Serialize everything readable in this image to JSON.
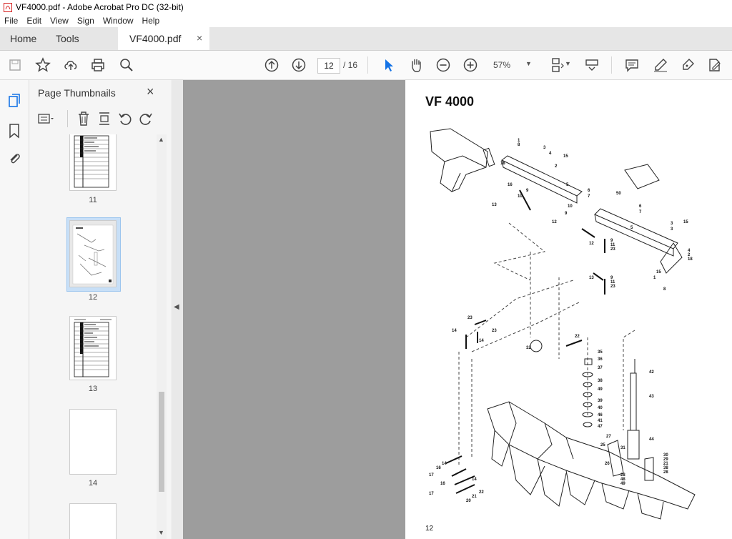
{
  "window": {
    "title": "VF4000.pdf - Adobe Acrobat Pro DC (32-bit)"
  },
  "menu": [
    "File",
    "Edit",
    "View",
    "Sign",
    "Window",
    "Help"
  ],
  "tabs": {
    "home": "Home",
    "tools": "Tools",
    "document": "VF4000.pdf",
    "close": "×"
  },
  "toolbar": {
    "current_page": "12",
    "total_pages": "/ 16",
    "zoom": "57%",
    "zoom_arrow": "▼"
  },
  "thumbnails_panel": {
    "title": "Page Thumbnails",
    "close": "×",
    "pages": [
      {
        "label": "11",
        "selected": false
      },
      {
        "label": "12",
        "selected": true
      },
      {
        "label": "13",
        "selected": false
      },
      {
        "label": "14",
        "selected": false
      }
    ]
  },
  "page": {
    "title": "VF 4000",
    "page_number": "12",
    "callouts": [
      "1",
      "2",
      "3",
      "4",
      "5",
      "6",
      "7",
      "8",
      "9",
      "10",
      "11",
      "12",
      "13",
      "14",
      "15",
      "16",
      "17",
      "18",
      "20",
      "21",
      "22",
      "23",
      "25",
      "26",
      "27",
      "28",
      "29",
      "30",
      "31",
      "32",
      "35",
      "36",
      "37",
      "38",
      "39",
      "40",
      "41",
      "42",
      "43",
      "44",
      "46",
      "47",
      "48",
      "49",
      "50"
    ]
  },
  "colors": {
    "accent": "#1473e6",
    "selected_thumb": "#c7dff7",
    "doc_bg": "#9d9d9d"
  }
}
